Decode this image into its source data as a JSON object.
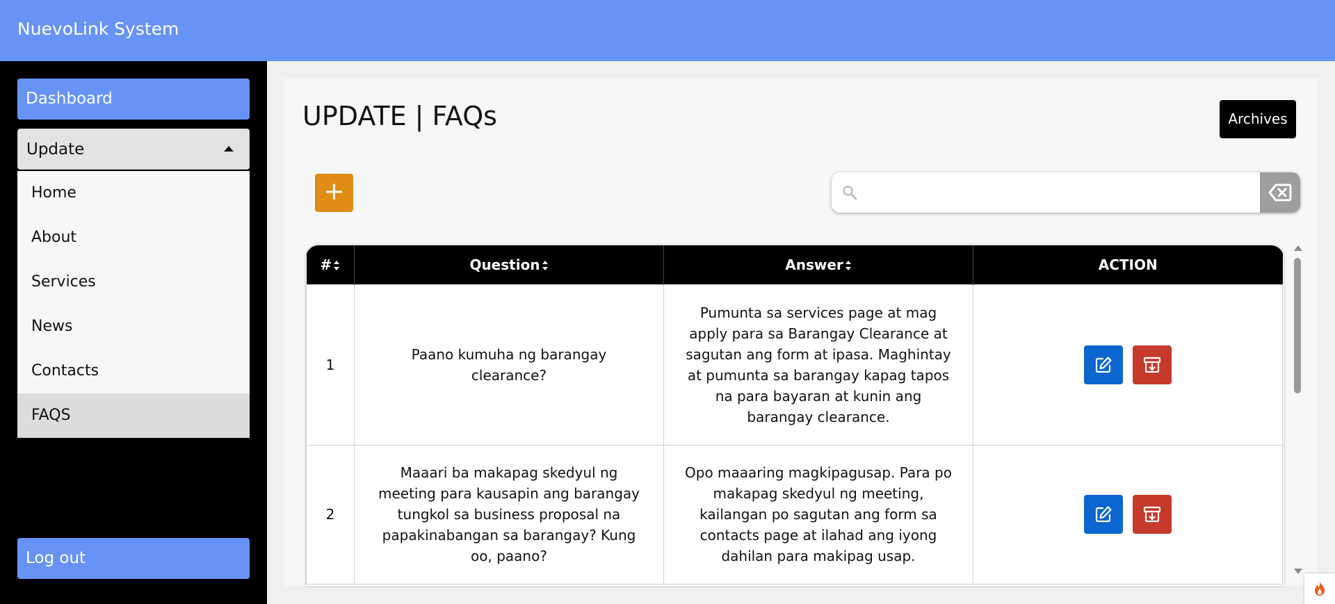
{
  "app": {
    "title": "NuevoLink System"
  },
  "sidebar": {
    "dashboard_label": "Dashboard",
    "update_label": "Update",
    "submenu": [
      {
        "label": "Home"
      },
      {
        "label": "About"
      },
      {
        "label": "Services"
      },
      {
        "label": "News"
      },
      {
        "label": "Contacts"
      },
      {
        "label": "FAQS",
        "active": true
      }
    ],
    "logout_label": "Log out"
  },
  "main": {
    "title": "UPDATE | FAQs",
    "archives_label": "Archives",
    "add_label": "+",
    "search": {
      "value": "",
      "placeholder": ""
    }
  },
  "table": {
    "headers": {
      "num": "#",
      "question": "Question",
      "answer": "Answer",
      "action": "ACTION"
    },
    "rows": [
      {
        "num": "1",
        "question": "Paano kumuha ng barangay clearance?",
        "answer": "Pumunta sa services page at mag apply para sa Barangay Clearance at sagutan ang form at ipasa. Maghintay at pumunta sa barangay kapag tapos na para bayaran at kunin ang barangay clearance."
      },
      {
        "num": "2",
        "question": "Maaari ba makapag skedyul ng meeting para kausapin ang barangay tungkol sa business proposal na papakinabangan sa barangay? Kung oo, paano?",
        "answer": "Opo maaaring magkipagusap. Para po makapag skedyul ng meeting, kailangan po sagutan ang form sa contacts page at ilahad ang iyong dahilan para makipag usap."
      }
    ]
  },
  "colors": {
    "topbar": "#6693f5",
    "sidebar": "#000000",
    "add_button": "#df8c14",
    "edit_button": "#0d66d0",
    "archive_button": "#c6392b"
  },
  "icons": [
    "search-icon",
    "backspace-icon",
    "sort-icon",
    "edit-icon",
    "archive-icon",
    "caret-up-icon",
    "flame-icon"
  ]
}
